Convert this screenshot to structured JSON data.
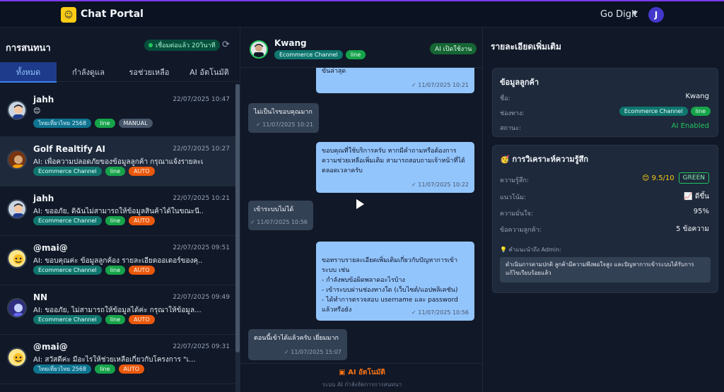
{
  "app": {
    "title": "Chat Portal",
    "org": "Go Digit",
    "user_initial": "J"
  },
  "left": {
    "title": "การสนทนา",
    "connection": "เชื่อมต่อแล้ว  20วินาที",
    "tabs": [
      "ทั้งหมด",
      "กำลังดูแล",
      "รอช่วยเหลือ",
      "AI อัตโนมัติ"
    ],
    "conversations": [
      {
        "name": "jahh",
        "time": "22/07/2025 10:47",
        "preview": "😊",
        "tags": [
          "ไทยเที่ยวไทย 2568",
          "line",
          "MANUAL"
        ]
      },
      {
        "name": "Golf Realtify AI",
        "time": "22/07/2025 10:27",
        "preview": "AI: เพื่อความปลอดภัยของข้อมูลลูกค้า กรุณาแจ้งรายละเ...",
        "tags": [
          "Ecommerce Channel",
          "line",
          "AUTO"
        ]
      },
      {
        "name": "jahh",
        "time": "22/07/2025 10:21",
        "preview": "AI: ขออภัย, ดิฉันไม่สามารถให้ข้อมูลสินค้าได้ในขณะนี...",
        "tags": [
          "Ecommerce Channel",
          "line",
          "AUTO"
        ]
      },
      {
        "name": "@mai@",
        "time": "22/07/2025 09:51",
        "preview": "AI: ขอบคุณค่ะ ข้อมูลลูกค้อง รายละเอียดออเดอร์ของคุ...",
        "tags": [
          "Ecommerce Channel",
          "line",
          "AUTO"
        ]
      },
      {
        "name": "NN",
        "time": "22/07/2025 09:49",
        "preview": "AI: ขออภัย, ไม่สามารถให้ข้อมูลได้ค่ะ กรุณาให้ข้อมูล...",
        "tags": [
          "Ecommerce Channel",
          "line",
          "AUTO"
        ]
      },
      {
        "name": "@mai@",
        "time": "22/07/2025 09:31",
        "preview": "AI: สวัสดีค่ะ มีอะไรให้ช่วยเหลือเกี่ยวกับโครงการ \"เ...",
        "tags": [
          "ไทยเที่ยวไทย 2568",
          "line",
          "AUTO"
        ]
      }
    ]
  },
  "chat": {
    "name": "Kwang",
    "tags": [
      "Ecommerce Channel",
      "line"
    ],
    "ai_status": "AI เปิดใช้งาน",
    "messages": [
      {
        "dir": "out",
        "text": "ขั้นล่าสุด",
        "time": "✓ 11/07/2025 10:21"
      },
      {
        "dir": "in",
        "text": "ไม่เป็นไรขอบคุณมาก",
        "time": "✓ 11/07/2025 10:21"
      },
      {
        "dir": "out",
        "text": "ขอบคุณที่ใช้บริการครับ หากมีคำถามหรือต้องการความช่วยเหลือเพิ่มเติม สามารถสอบถามเจ้าหน้าที่ได้ตลอดเวลาครับ",
        "time": "✓ 11/07/2025 10:22"
      },
      {
        "dir": "in",
        "text": "เข้าระบบไม่ได้",
        "time": "✓ 11/07/2025 10:56"
      },
      {
        "dir": "out",
        "text": "ขอทราบรายละเอียดเพิ่มเติมเกี่ยวกับปัญหาการเข้าระบบ เช่น\n- กำลังพบข้อผิดพลาดอะไรบ้าง\n- เข้าระบบผ่านช่องทางใด (เว็บไซต์/แอปพลิเคชัน)\n- ได้ทำการตรวจสอบ username และ password แล้วหรือยัง",
        "time": "✓ 11/07/2025 10:56"
      },
      {
        "dir": "in",
        "text": "ตอนนี้เข้าได้แล้วครับ เยี่ยมมาก",
        "time": "✓ 11/07/2025 15:07"
      }
    ],
    "footer_mode": "AI อัตโนมัติ",
    "footer_sub": "ระบบ AI กำลังจัดการการสนทนา"
  },
  "details": {
    "title": "รายละเอียดเพิ่มเติม",
    "customer": {
      "title": "ข้อมูลลูกค้า",
      "name_label": "ชื่อ:",
      "name": "Kwang",
      "channel_label": "ช่องทาง:",
      "channel_tags": [
        "Ecommerce Channel",
        "line"
      ],
      "status_label": "สถานะ:",
      "status": "AI Enabled"
    },
    "sentiment": {
      "title": "การวิเคราะห์ความรู้สึก",
      "feeling_label": "ความรู้สึก:",
      "score": "😊 9.5/10",
      "grade": "GREEN",
      "trend_label": "แนวโน้ม:",
      "trend": "📈 ดีขึ้น",
      "confidence_label": "ความมั่นใจ:",
      "confidence": "95%",
      "messages_label": "ข้อความลูกค้า:",
      "messages": "5 ข้อความ",
      "note_label": "💡 คำแนะนำถึง Admin:",
      "note": "ดำเนินการตามปกติ ลูกค้ามีความพึงพอใจสูง และปัญหาการเข้าระบบได้รับการแก้ไขเรียบร้อยแล้ว"
    }
  },
  "colors": {
    "accent": "#7c3aed",
    "positive": "#22c55e",
    "auto": "#ea580c",
    "bubble_out": "#93c5fd"
  }
}
